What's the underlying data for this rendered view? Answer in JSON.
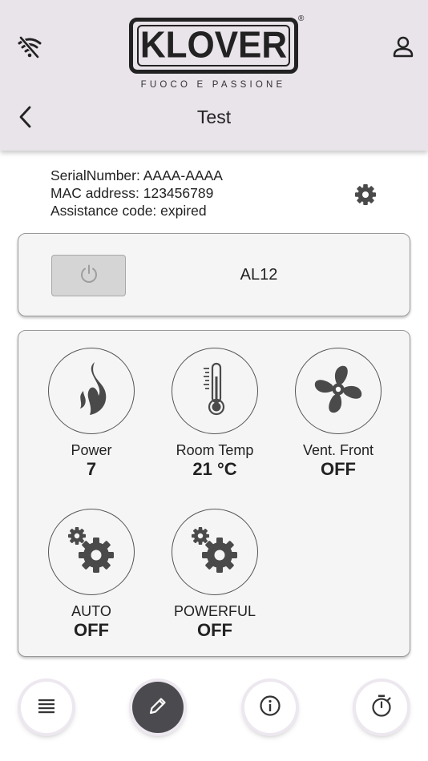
{
  "header": {
    "logo_text": "KLOVER",
    "logo_reg": "®",
    "tagline": "FUOCO E PASSIONE",
    "title": "Test",
    "icons": {
      "connection": "wifi-off-icon",
      "user": "user-icon",
      "back": "chevron-left-icon"
    }
  },
  "device": {
    "serial": "SerialNumber: AAAA-AAAA",
    "mac": "MAC address: 123456789",
    "assistance": "Assistance code: expired",
    "settings_icon": "gear-icon"
  },
  "status": {
    "power_icon": "power-icon",
    "alarm": "AL12"
  },
  "controls": [
    {
      "label": "Power",
      "value": "7",
      "icon": "flame-icon"
    },
    {
      "label": "Room Temp",
      "value": "21 °C",
      "icon": "thermometer-icon"
    },
    {
      "label": "Vent. Front",
      "value": "OFF",
      "icon": "fan-icon"
    },
    {
      "label": "AUTO",
      "value": "OFF",
      "icon": "gears-icon"
    },
    {
      "label": "POWERFUL",
      "value": "OFF",
      "icon": "gears-icon"
    }
  ],
  "bottom_nav": [
    {
      "icon": "list-icon",
      "active": false
    },
    {
      "icon": "pencil-icon",
      "active": true
    },
    {
      "icon": "info-icon",
      "active": false
    },
    {
      "icon": "timer-icon",
      "active": false
    }
  ],
  "colors": {
    "header_bg": "#e9e3ea",
    "card_bg": "#f5f5f5",
    "icon_dark": "#4a4a4a",
    "active_fab": "#4b4b4f"
  }
}
